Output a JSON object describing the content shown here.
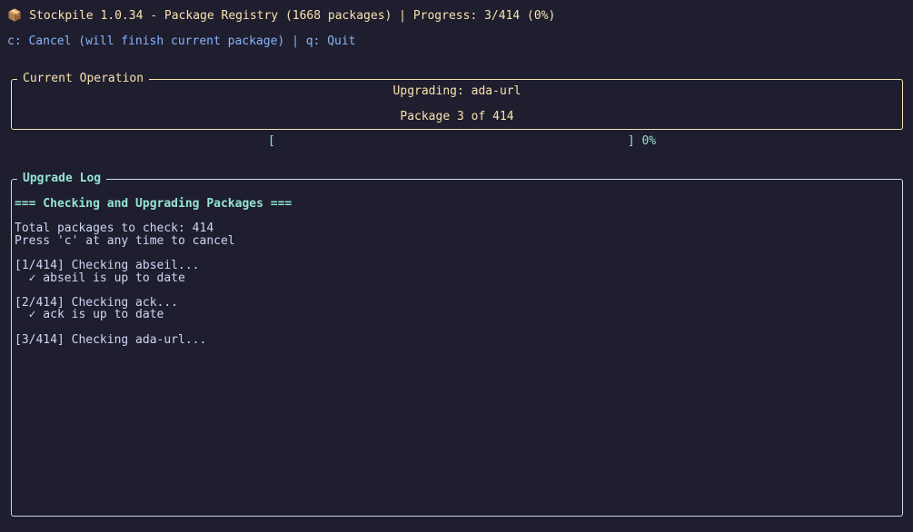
{
  "header": {
    "app_icon": "package-icon",
    "title": "Stockpile 1.0.34 - Package Registry (1668 packages) | Progress: 3/414 (0%)",
    "keybinds": "c: Cancel (will finish current package) | q: Quit"
  },
  "current_operation": {
    "title": "Current Operation",
    "upgrading": "Upgrading: ada-url",
    "package_counter": "Package 3 of 414"
  },
  "progress": {
    "left_bracket": "[",
    "right_bracket": "]",
    "percent_label": "0%",
    "fraction": 0.0
  },
  "upgrade_log": {
    "title": "Upgrade Log",
    "heading": "=== Checking and Upgrading Packages ===",
    "total": "Total packages to check: 414",
    "cancel_hint": "Press 'c' at any time to cancel",
    "entries": [
      {
        "check": "[1/414] Checking abseil...",
        "result": "  ✓ abseil is up to date"
      },
      {
        "check": "[2/414] Checking ack...",
        "result": "  ✓ ack is up to date"
      },
      {
        "check": "[3/414] Checking ada-url...",
        "result": ""
      }
    ]
  },
  "colors": {
    "background": "#1e1e2e",
    "accent_yellow": "#f9e2af",
    "accent_teal": "#94e2d5",
    "accent_blue": "#89b4fa",
    "text": "#cdd6f4"
  }
}
